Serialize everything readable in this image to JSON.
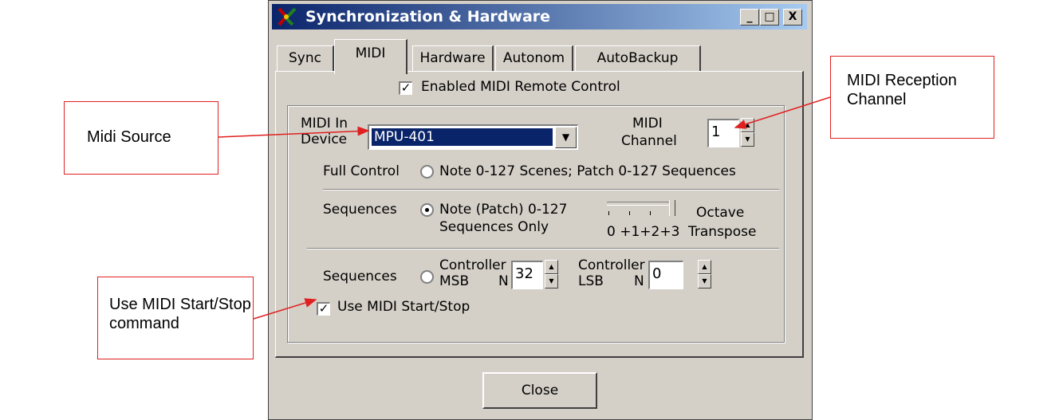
{
  "window": {
    "title": "Synchronization & Hardware",
    "controls": {
      "minimize": "_",
      "maximize": "□",
      "close": "X"
    }
  },
  "tabs": [
    "Sync",
    "MIDI",
    "Hardware",
    "Autonom",
    "AutoBackup"
  ],
  "active_tab": "MIDI",
  "enable_remote": {
    "label": "Enabled MIDI Remote Control",
    "checked": true
  },
  "midi_in": {
    "label_line1": "MIDI In",
    "label_line2": "Device",
    "value": "MPU-401"
  },
  "midi_channel": {
    "label_line1": "MIDI",
    "label_line2": "Channel",
    "value": "1"
  },
  "mode_full": {
    "label": "Full Control",
    "desc": "Note 0-127 Scenes; Patch 0-127 Sequences",
    "selected": false
  },
  "mode_seq_note": {
    "label": "Sequences",
    "desc_line1": "Note (Patch) 0-127",
    "desc_line2": "Sequences Only",
    "selected": true,
    "octave_ticks": "0 +1+2+3",
    "octave_label_line1": "Octave",
    "octave_label_line2": "Transpose",
    "octave_value": 0
  },
  "mode_seq_ctrl": {
    "label": "Sequences",
    "selected": false,
    "msb_line1": "Controller",
    "msb_line2": "MSB",
    "msb_n": "N",
    "msb_value": "32",
    "lsb_line1": "Controller",
    "lsb_line2": "LSB",
    "lsb_n": "N",
    "lsb_value": "0"
  },
  "start_stop": {
    "label": "Use MIDI Start/Stop",
    "checked": true
  },
  "close_label": "Close",
  "callouts": {
    "midi_source": "Midi Source",
    "reception_channel_line1": "MIDI Reception",
    "reception_channel_line2": "Channel",
    "start_stop_line1": "Use MIDI Start/Stop",
    "start_stop_line2": "command"
  },
  "colors": {
    "dialog_face": "#d4d0c8",
    "title_start": "#0a246a",
    "title_end": "#a6caf0",
    "annotation": "#e02020"
  }
}
